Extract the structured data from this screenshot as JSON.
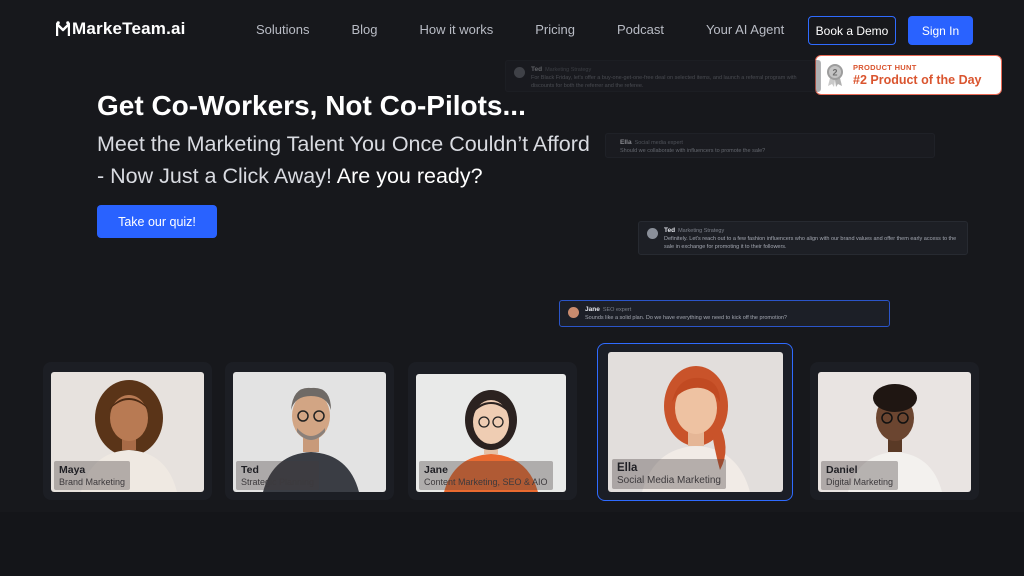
{
  "brand": {
    "logo_text": "MarkeTeam.ai"
  },
  "nav": {
    "items": [
      "Solutions",
      "Blog",
      "How it works",
      "Pricing",
      "Podcast",
      "Your AI Agent"
    ]
  },
  "header": {
    "book_demo": "Book a Demo",
    "sign_in": "Sign In"
  },
  "product_hunt": {
    "label": "PRODUCT HUNT",
    "title": "#2 Product of the Day",
    "rank": "2"
  },
  "hero": {
    "title": "Get Co-Workers, Not Co-Pilots...",
    "subtitle_line1": "Meet the Marketing Talent You Once Couldn’t Afford",
    "subtitle_line2": "- Now Just a Click Away!",
    "subtitle_strong": "Are you ready?",
    "cta": "Take our quiz!"
  },
  "chat": [
    {
      "name": "Ted",
      "role": "Marketing Strategy",
      "text": "For Black Friday, let's offer a buy-one-get-one-free deal on selected items, and launch a referral program with discounts for both the referrer and the referee."
    },
    {
      "name": "Ella",
      "role": "Social media expert",
      "text": "Should we collaborate with influencers to promote the sale?"
    },
    {
      "name": "Ted",
      "role": "Marketing Strategy",
      "text": "Definitely. Let's reach out to a few fashion influencers who align with our brand values and offer them early access to the sale in exchange for promoting it to their followers."
    },
    {
      "name": "Jane",
      "role": "SEO expert",
      "text": "Sounds like a solid plan. Do we have everything we need to kick off the promotion?"
    }
  ],
  "team": [
    {
      "name": "Maya",
      "role": "Brand Marketing"
    },
    {
      "name": "Ted",
      "role": "Strategic Planning"
    },
    {
      "name": "Jane",
      "role": "Content Marketing, SEO & AIO"
    },
    {
      "name": "Ella",
      "role": "Social Media Marketing"
    },
    {
      "name": "Daniel",
      "role": "Digital Marketing"
    }
  ],
  "colors": {
    "accent": "#2962ff",
    "background": "#17181c",
    "product_hunt": "#da552f"
  }
}
